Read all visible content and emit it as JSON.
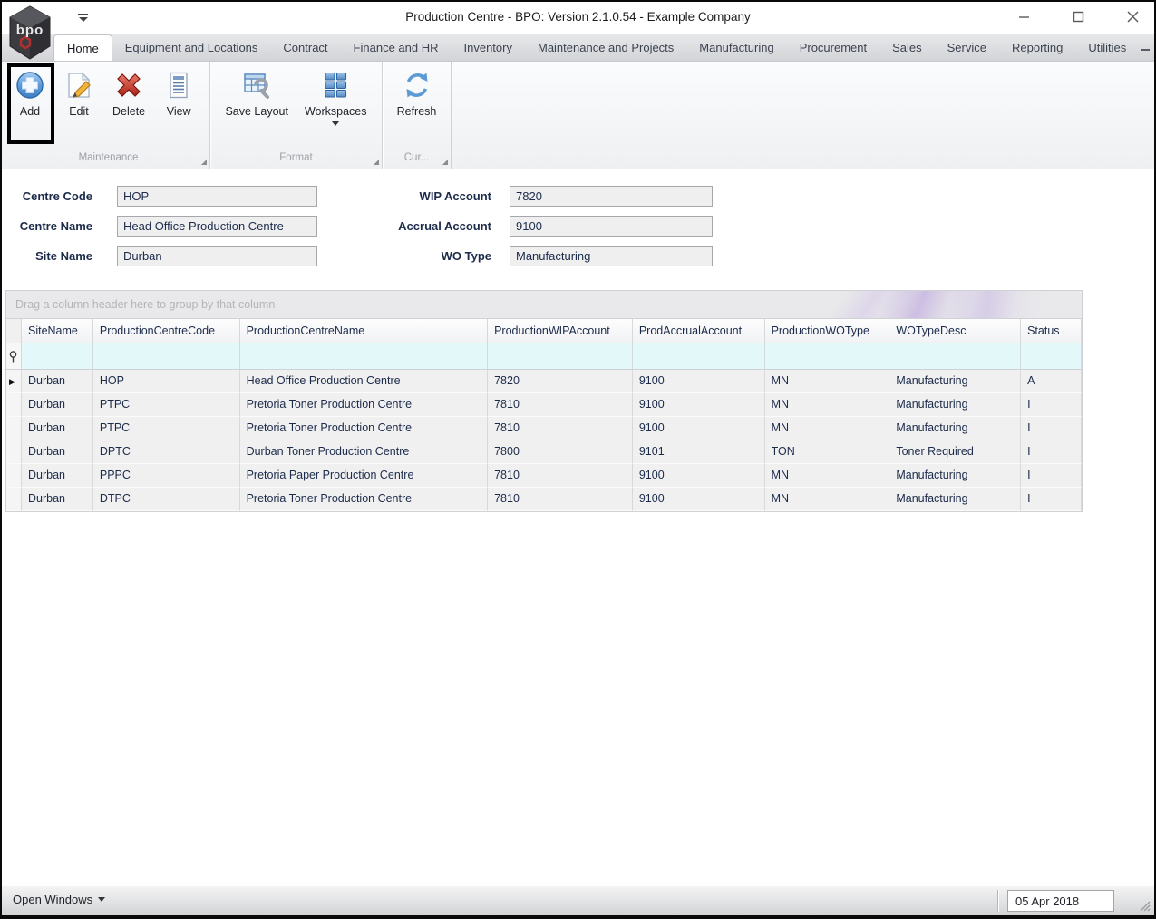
{
  "window": {
    "title": "Production Centre - BPO: Version 2.1.0.54 - Example Company",
    "logo_text": "bpo"
  },
  "menu": {
    "active_tab": "Home",
    "tabs": [
      "Home",
      "Equipment and Locations",
      "Contract",
      "Finance and HR",
      "Inventory",
      "Maintenance and Projects",
      "Manufacturing",
      "Procurement",
      "Sales",
      "Service",
      "Reporting",
      "Utilities"
    ]
  },
  "ribbon": {
    "groups": [
      {
        "caption": "Maintenance"
      },
      {
        "caption": "Format"
      },
      {
        "caption": "Cur..."
      }
    ],
    "buttons": {
      "add": "Add",
      "edit": "Edit",
      "delete": "Delete",
      "view": "View",
      "save_layout": "Save Layout",
      "workspaces": "Workspaces",
      "refresh": "Refresh"
    }
  },
  "form": {
    "left": [
      {
        "label": "Centre Code",
        "value": "HOP"
      },
      {
        "label": "Centre Name",
        "value": "Head Office Production Centre"
      },
      {
        "label": "Site Name",
        "value": "Durban"
      }
    ],
    "right": [
      {
        "label": "WIP Account",
        "value": "7820"
      },
      {
        "label": "Accrual Account",
        "value": "9100"
      },
      {
        "label": "WO Type",
        "value": "Manufacturing"
      }
    ]
  },
  "grid": {
    "group_panel_text": "Drag a column header here to group by that column",
    "columns": [
      "SiteName",
      "ProductionCentreCode",
      "ProductionCentreName",
      "ProductionWIPAccount",
      "ProdAccrualAccount",
      "ProductionWOType",
      "WOTypeDesc",
      "Status"
    ],
    "current_row_index": 0,
    "rows": [
      [
        "Durban",
        "HOP",
        "Head Office Production Centre",
        "7820",
        "9100",
        "MN",
        "Manufacturing",
        "A"
      ],
      [
        "Durban",
        "PTPC",
        "Pretoria Toner Production Centre",
        "7810",
        "9100",
        "MN",
        "Manufacturing",
        "I"
      ],
      [
        "Durban",
        "PTPC",
        "Pretoria Toner Production Centre",
        "7810",
        "9100",
        "MN",
        "Manufacturing",
        "I"
      ],
      [
        "Durban",
        "DPTC",
        "Durban Toner Production Centre",
        "7800",
        "9101",
        "TON",
        "Toner Required",
        "I"
      ],
      [
        "Durban",
        "PPPC",
        "Pretoria Paper Production Centre",
        "7810",
        "9100",
        "MN",
        "Manufacturing",
        "I"
      ],
      [
        "Durban",
        "DTPC",
        "Pretoria Toner Production Centre",
        "7810",
        "9100",
        "MN",
        "Manufacturing",
        "I"
      ]
    ]
  },
  "status_bar": {
    "open_windows_label": "Open Windows",
    "date_value": "05 Apr 2018"
  },
  "icons": {
    "add": "plus-circle",
    "edit": "page-pencil",
    "delete": "red-x",
    "view": "document-lines",
    "save_layout": "table-wrench",
    "workspaces": "tile-grid",
    "refresh": "circular-arrows",
    "filter_row": "pushpin"
  },
  "colors": {
    "accent_blue": "#4a90d9",
    "filter_row_cyan": "#e2f8f9",
    "delete_red": "#c43c30",
    "annotation_black": "#000000",
    "group_swoosh_purple": "#9e78d4"
  }
}
